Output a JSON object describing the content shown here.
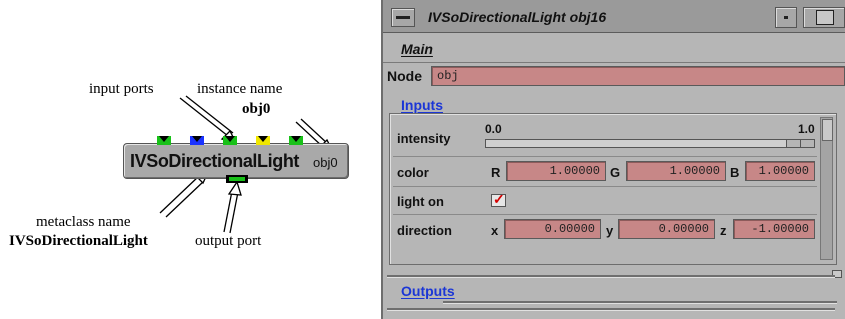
{
  "diagram": {
    "annotations": {
      "input_ports": "input ports",
      "instance_name": "instance name",
      "instance_name_value": "obj0",
      "metaclass_name": "metaclass name",
      "metaclass_name_value": "IVSoDirectionalLight",
      "output_port": "output port"
    },
    "module": {
      "metaclass": "IVSoDirectionalLight",
      "instance": "obj0"
    },
    "port_colors": [
      "#19c119",
      "#1a33ff",
      "#19c119",
      "#f0e600",
      "#19c119"
    ]
  },
  "window": {
    "title": "IVSoDirectionalLight obj16",
    "menu": {
      "main": "Main"
    },
    "node": {
      "label": "Node",
      "value": "obj"
    },
    "inputs_title": "Inputs",
    "outputs_title": "Outputs",
    "params": {
      "intensity": {
        "label": "intensity",
        "min": "0.0",
        "max": "1.0",
        "value_fraction": 1.0
      },
      "color": {
        "label": "color",
        "r_label": "R",
        "r": "1.00000",
        "g_label": "G",
        "g": "1.00000",
        "b_label": "B",
        "b": "1.00000"
      },
      "light_on": {
        "label": "light on",
        "checked": true,
        "check_glyph": "✓"
      },
      "direction": {
        "label": "direction",
        "x_label": "x",
        "x": "0.00000",
        "y_label": "y",
        "y": "0.00000",
        "z_label": "z",
        "z": "-1.00000"
      }
    },
    "colors": {
      "field_bg": "#c78787",
      "section_title": "#1b36d6",
      "window_bg": "#b6b6b6"
    }
  }
}
